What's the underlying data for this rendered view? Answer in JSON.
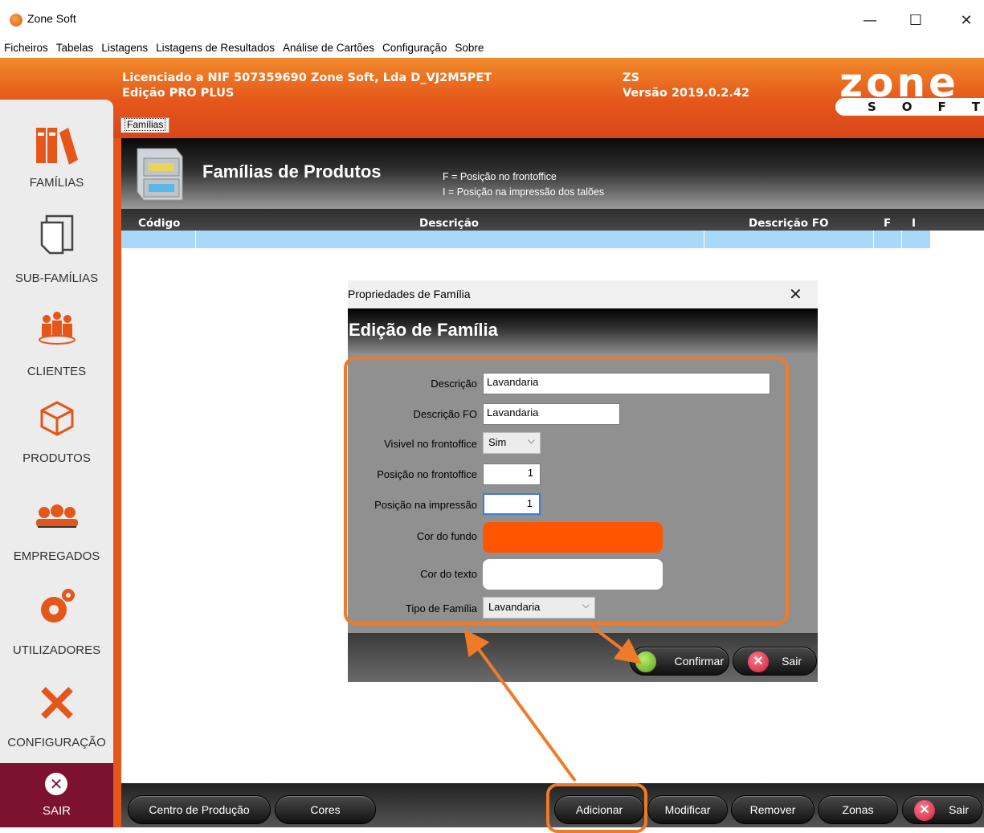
{
  "window": {
    "title": "Zone Soft",
    "minimize": "—",
    "maximize": "☐",
    "close": "✕"
  },
  "menu": [
    "Ficheiros",
    "Tabelas",
    "Listagens",
    "Listagens de Resultados",
    "Análise de Cartões",
    "Configuração",
    "Sobre"
  ],
  "header": {
    "license_line": "Licenciado a NIF 507359690 Zone Soft, Lda D_VJ2M5PET",
    "edition": "Edição PRO PLUS",
    "code": "ZS",
    "version": "Versão 2019.0.2.42",
    "logo_zone": "zone",
    "logo_soft": "SOFT"
  },
  "tab": "Famílias",
  "sidebar": {
    "items": [
      {
        "label": "FAMÍLIAS",
        "icon": "binders-icon"
      },
      {
        "label": "SUB-FAMÍLIAS",
        "icon": "documents-icon"
      },
      {
        "label": "CLIENTES",
        "icon": "people-icon"
      },
      {
        "label": "PRODUTOS",
        "icon": "box-icon"
      },
      {
        "label": "EMPREGADOS",
        "icon": "employees-icon"
      },
      {
        "label": "UTILIZADORES",
        "icon": "gears-icon"
      },
      {
        "label": "CONFIGURAÇÃO",
        "icon": "tools-icon"
      }
    ],
    "exit": "SAIR"
  },
  "panel": {
    "title": "Famílias de Produtos",
    "note1": "F = Posição no frontoffice",
    "note2": "I = Posição na impressão dos talões"
  },
  "table": {
    "columns": [
      "Código",
      "Descrição",
      "Descrição FO",
      "F",
      "I"
    ]
  },
  "dialog": {
    "title": "Propriedades de Família",
    "close": "✕",
    "heading": "Edição de Família",
    "fields": {
      "descricao_label": "Descrição",
      "descricao_value": "Lavandaria",
      "descricao_fo_label": "Descrição FO",
      "descricao_fo_value": "Lavandaria",
      "visivel_label": "Visivel no frontoffice",
      "visivel_value": "Sim",
      "pos_front_label": "Posição no frontoffice",
      "pos_front_value": "1",
      "pos_imp_label": "Posição na impressão",
      "pos_imp_value": "1",
      "cor_fundo_label": "Cor do fundo",
      "cor_fundo_color": "#ff5500",
      "cor_texto_label": "Cor do texto",
      "cor_texto_color": "#ffffff",
      "tipo_label": "Tipo de Família",
      "tipo_value": "Lavandaria"
    },
    "confirm": "Confirmar",
    "exit": "Sair"
  },
  "bottom": {
    "centro": "Centro de Produção",
    "cores": "Cores",
    "adicionar": "Adicionar",
    "modificar": "Modificar",
    "remover": "Remover",
    "zonas": "Zonas",
    "sair": "Sair"
  },
  "colors": {
    "accent": "#e5561a",
    "highlight": "#ee7b2a",
    "selected_row": "#a9d8f9",
    "exit_bg": "#7c1230"
  }
}
